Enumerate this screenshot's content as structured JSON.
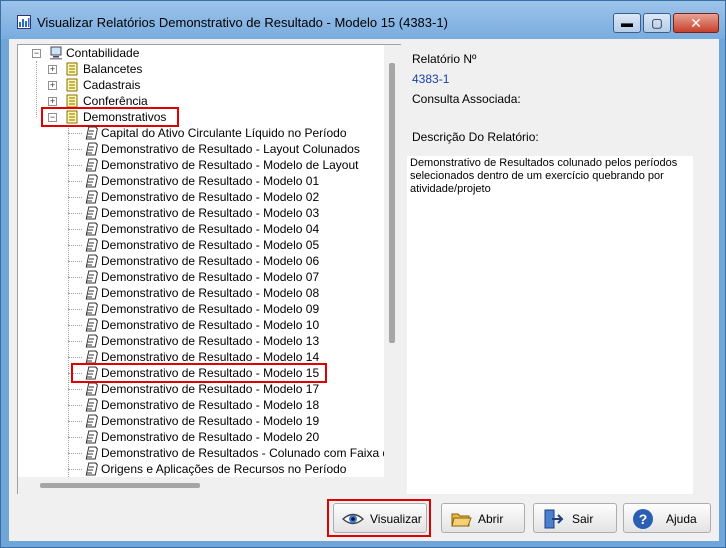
{
  "window": {
    "title": "Visualizar Relatórios Demonstrativo de Resultado - Modelo 15 (4383-1)",
    "minimize_glyph": "▬",
    "maximize_glyph": "▢",
    "close_glyph": "✕"
  },
  "tree": {
    "root": "Contabilidade",
    "folders": [
      "Balancetes",
      "Cadastrais",
      "Conferência",
      "Demonstrativos"
    ],
    "expand_collapsed": "+",
    "expand_open": "−",
    "reports": [
      "Capital do Ativo Circulante Líquido no Período",
      "Demonstrativo de Resultado - Layout Colunados",
      "Demonstrativo de Resultado - Modelo de Layout",
      "Demonstrativo de Resultado - Modelo 01",
      "Demonstrativo de Resultado - Modelo 02",
      "Demonstrativo de Resultado - Modelo 03",
      "Demonstrativo de Resultado - Modelo 04",
      "Demonstrativo de Resultado - Modelo 05",
      "Demonstrativo de Resultado - Modelo 06",
      "Demonstrativo de Resultado - Modelo 07",
      "Demonstrativo de Resultado - Modelo 08",
      "Demonstrativo de Resultado - Modelo 09",
      "Demonstrativo de Resultado - Modelo 10",
      "Demonstrativo de Resultado - Modelo 13",
      "Demonstrativo de Resultado - Modelo 14",
      "Demonstrativo de Resultado - Modelo 15",
      "Demonstrativo de Resultado - Modelo 17",
      "Demonstrativo de Resultado - Modelo 18",
      "Demonstrativo de Resultado - Modelo 19",
      "Demonstrativo de Resultado - Modelo 20",
      "Demonstrativo de Resultados - Colunado com Faixa d",
      "Origens e Aplicações de Recursos no Período"
    ]
  },
  "info": {
    "report_number_label": "Relatório Nº",
    "report_number": "4383-1",
    "associated_query_label": "Consulta Associada:",
    "description_label": "Descrição Do Relatório:",
    "description": "Demonstrativo de Resultados colunado pelos períodos selecionados dentro de um exercício quebrando por atividade/projeto"
  },
  "buttons": {
    "visualizar": "Visualizar",
    "abrir": "Abrir",
    "sair": "Sair",
    "ajuda": "Ajuda"
  },
  "colors": {
    "highlight_red": "#e00000",
    "link_blue": "#1a3fa8",
    "title_blue": "#79acdf"
  }
}
